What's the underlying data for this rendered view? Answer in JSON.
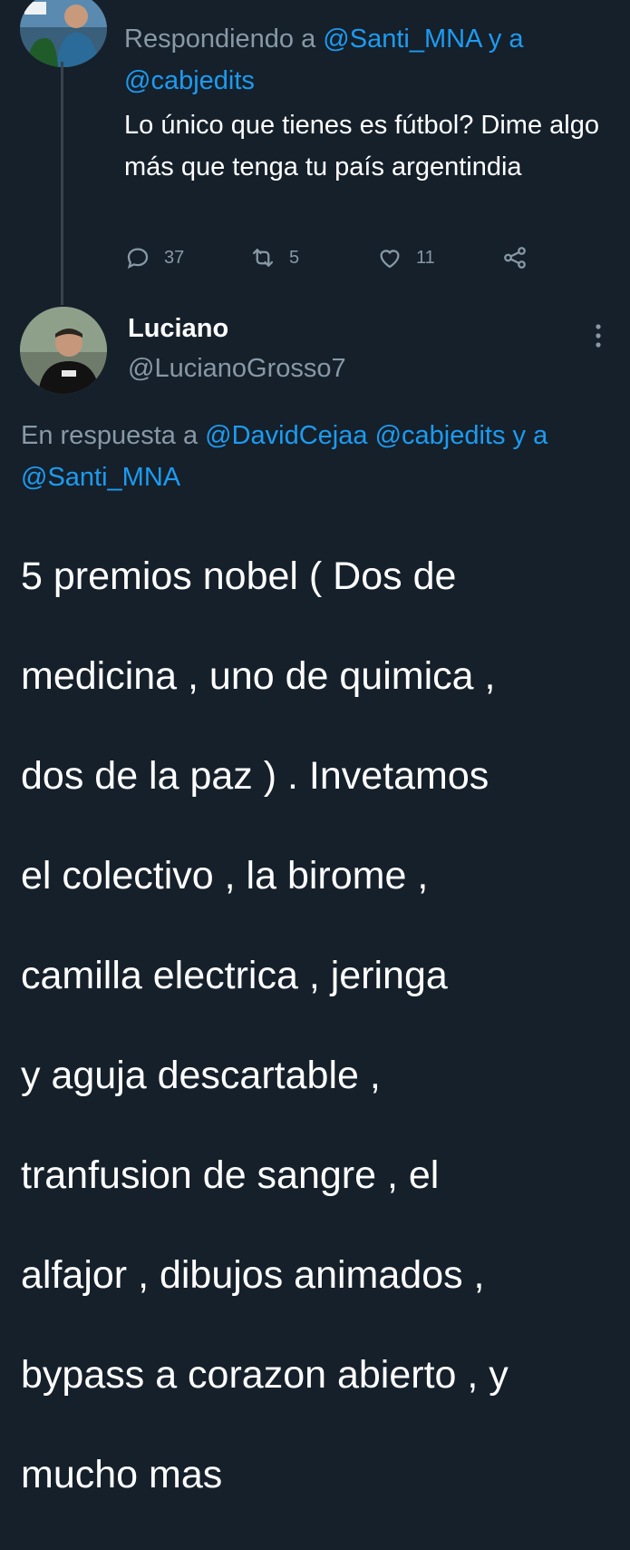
{
  "top_tweet": {
    "reply_prefix": "Respondiendo a",
    "mention_1": "@Santi_MNA",
    "reply_joiner": "y a",
    "mention_2": "@cabjedits",
    "text": "Lo único que tienes es fútbol? Dime algo más que tenga tu país argentindia",
    "actions": {
      "reply": {
        "icon": "speech-bubble-icon",
        "count": "37"
      },
      "retweet": {
        "icon": "retweet-icon",
        "count": "5"
      },
      "like": {
        "icon": "heart-icon",
        "count": "11"
      },
      "share": {
        "icon": "share-icon"
      }
    }
  },
  "main_tweet": {
    "author": {
      "name": "Luciano",
      "handle": "@LucianoGrosso7"
    },
    "reply_prefix": "En respuesta a",
    "mention_1": "@DavidCejaa",
    "mention_2": "@cabjedits",
    "reply_joiner": "y a",
    "mention_3": "@Santi_MNA",
    "lines": [
      "5 premios nobel ( Dos de",
      "medicina , uno de quimica ,",
      "dos de la paz ) . Invetamos",
      "el colectivo , la birome ,",
      "camilla electrica , jeringa",
      "y aguja descartable ,",
      "tranfusion de sangre , el",
      "alfajor , dibujos animados ,",
      "bypass a corazon abierto , y",
      "mucho mas"
    ]
  },
  "colors": {
    "background": "#15202b",
    "link": "#1d9bf0",
    "muted": "#8899a6",
    "text": "#ffffff"
  }
}
